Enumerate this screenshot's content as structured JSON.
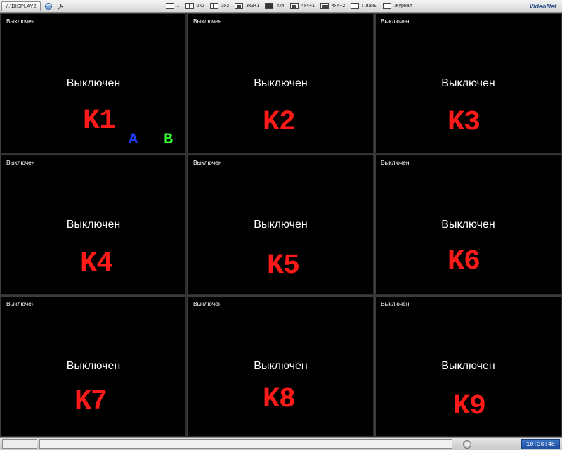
{
  "toolbar": {
    "display_tab": "\\\\.\\DISPLAY2",
    "layouts": [
      {
        "label": "1"
      },
      {
        "label": "2x2"
      },
      {
        "label": "3x3"
      },
      {
        "label": "3x3+1"
      },
      {
        "label": "4x4"
      },
      {
        "label": "4x4+1"
      },
      {
        "label": "4x4+2"
      },
      {
        "label": "Планы"
      },
      {
        "label": "Журнал"
      }
    ],
    "brand": "VideoNet"
  },
  "cells": [
    {
      "status": "Выключен",
      "center": "Выключен",
      "label": "K1"
    },
    {
      "status": "Выключен",
      "center": "Выключен",
      "label": "K2"
    },
    {
      "status": "Выключен",
      "center": "Выключен",
      "label": "K3"
    },
    {
      "status": "Выключен",
      "center": "Выключен",
      "label": "K4"
    },
    {
      "status": "Выключен",
      "center": "Выключен",
      "label": "K5"
    },
    {
      "status": "Выключен",
      "center": "Выключен",
      "label": "K6"
    },
    {
      "status": "Выключен",
      "center": "Выключен",
      "label": "K7"
    },
    {
      "status": "Выключен",
      "center": "Выключен",
      "label": "K8"
    },
    {
      "status": "Выключен",
      "center": "Выключен",
      "label": "K9"
    }
  ],
  "markers": {
    "a": "A",
    "b": "B"
  },
  "colors": {
    "label": "#ff1a1a",
    "marker_a": "#1f3cff",
    "marker_b": "#33ff33",
    "clock_bg": "#2a5fb4"
  },
  "statusbar": {
    "clock": "10:36:48"
  }
}
